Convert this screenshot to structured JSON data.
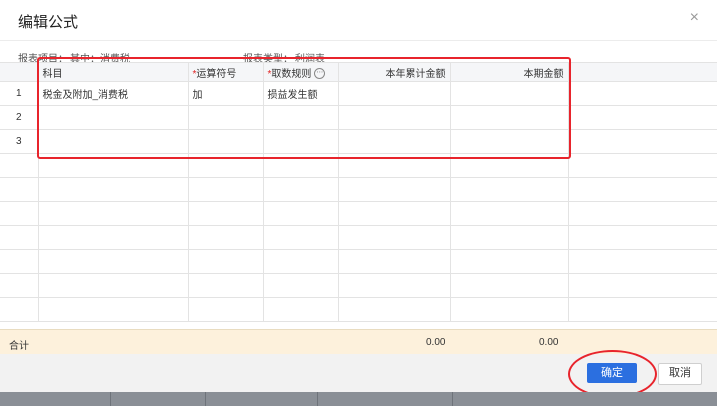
{
  "dialog": {
    "title": "编辑公式",
    "close_glyph": "×"
  },
  "meta": {
    "report_item_label": "报表项目：",
    "report_item_value": "其中：消费税",
    "report_type_label": "报表类型：",
    "report_type_value": "利润表"
  },
  "grid": {
    "headers": {
      "subject": "科目",
      "operator": "运算符号",
      "rule": "取数规则",
      "ytd": "本年累计金额",
      "period": "本期金额"
    },
    "rows": [
      {
        "idx": "1",
        "subject": "税金及附加_消费税",
        "operator": "加",
        "rule": "损益发生额",
        "ytd": "",
        "period": ""
      },
      {
        "idx": "2",
        "subject": "",
        "operator": "",
        "rule": "",
        "ytd": "",
        "period": ""
      },
      {
        "idx": "3",
        "subject": "",
        "operator": "",
        "rule": "",
        "ytd": "",
        "period": ""
      }
    ]
  },
  "totals": {
    "label": "合计",
    "ytd": "0.00",
    "period": "0.00"
  },
  "buttons": {
    "ok": "确定",
    "cancel": "取消"
  },
  "colors": {
    "primary": "#2b6fe0",
    "highlight": "#e8242c",
    "total_bg": "#fdf1dc"
  }
}
